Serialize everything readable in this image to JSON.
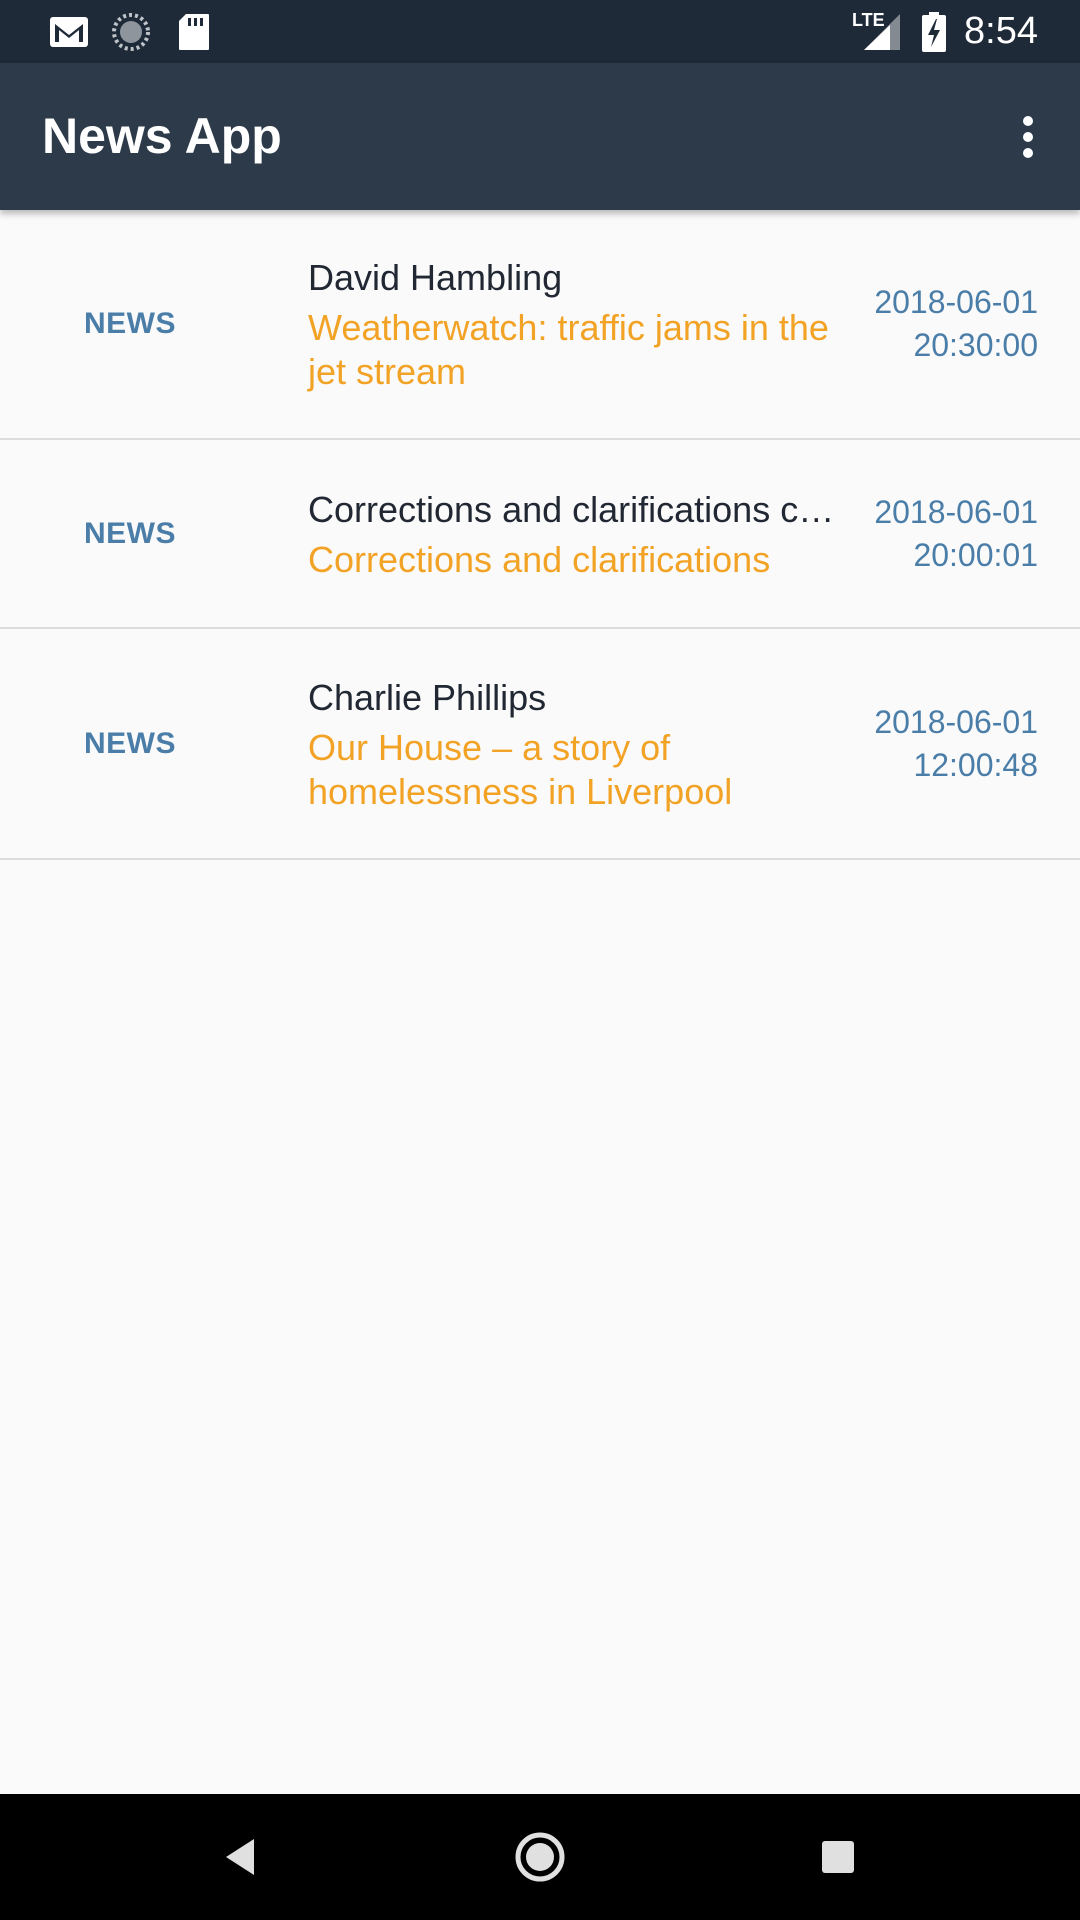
{
  "status_bar": {
    "time": "8:54",
    "network_label": "LTE",
    "left_icons": [
      "gmail-icon",
      "sync-icon",
      "sd-card-icon"
    ],
    "right_icons": [
      "signal-icon",
      "battery-charging-icon"
    ]
  },
  "app_bar": {
    "title": "News App",
    "menu_icon": "more-vert-icon"
  },
  "news_items": [
    {
      "section": "NEWS",
      "author": "David Hambling",
      "headline": "Weatherwatch: traffic jams in the jet stream",
      "date": "2018-06-01",
      "time": "20:30:00"
    },
    {
      "section": "NEWS",
      "author": "Corrections and clarifications c…",
      "headline": "Corrections and clarifications",
      "date": "2018-06-01",
      "time": "20:00:01"
    },
    {
      "section": "NEWS",
      "author": "Charlie Phillips",
      "headline": "Our House – a story of homelessness in Liverpool",
      "date": "2018-06-01",
      "time": "12:00:48"
    }
  ],
  "nav_bar": {
    "buttons": [
      "back-icon",
      "home-icon",
      "recents-icon"
    ]
  },
  "colors": {
    "status_bar_bg": "#1F2A38",
    "app_bar_bg": "#2C3A4A",
    "section_color": "#4A7DA8",
    "headline_color": "#F2A325",
    "author_color": "#212833",
    "background": "#FAFAFA"
  }
}
